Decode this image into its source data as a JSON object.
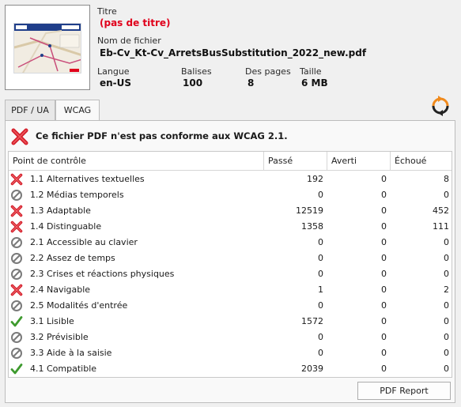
{
  "document": {
    "title_label": "Titre",
    "title_value": "(pas de titre)",
    "filename_label": "Nom de fichier",
    "filename_value": "Eb-Cv_Kt-Cv_ArretsBusSubstitution_2022_new.pdf",
    "language_label": "Langue",
    "language_value": "en-US",
    "tags_label": "Balises",
    "tags_value": "100",
    "pages_label": "Des pages",
    "pages_value": "8",
    "size_label": "Taille",
    "size_value": "6 MB"
  },
  "tabs": [
    {
      "label": "PDF / UA",
      "active": false
    },
    {
      "label": "WCAG",
      "active": true
    }
  ],
  "status": {
    "icon": "red-x-icon",
    "text": "Ce fichier PDF n'est pas conforme aux WCAG 2.1."
  },
  "table": {
    "columns": [
      "Point de contrôle",
      "Passé",
      "Averti",
      "Échoué"
    ],
    "rows": [
      {
        "status": "fail",
        "name": "1.1 Alternatives textuelles",
        "passed": "192",
        "warned": "0",
        "failed": "8"
      },
      {
        "status": "na",
        "name": "1.2 Médias temporels",
        "passed": "0",
        "warned": "0",
        "failed": "0"
      },
      {
        "status": "fail",
        "name": "1.3 Adaptable",
        "passed": "12519",
        "warned": "0",
        "failed": "452"
      },
      {
        "status": "fail",
        "name": "1.4 Distinguable",
        "passed": "1358",
        "warned": "0",
        "failed": "111"
      },
      {
        "status": "na",
        "name": "2.1 Accessible au clavier",
        "passed": "0",
        "warned": "0",
        "failed": "0"
      },
      {
        "status": "na",
        "name": "2.2 Assez de temps",
        "passed": "0",
        "warned": "0",
        "failed": "0"
      },
      {
        "status": "na",
        "name": "2.3 Crises et réactions physiques",
        "passed": "0",
        "warned": "0",
        "failed": "0"
      },
      {
        "status": "fail",
        "name": "2.4 Navigable",
        "passed": "1",
        "warned": "0",
        "failed": "2"
      },
      {
        "status": "na",
        "name": "2.5 Modalités d'entrée",
        "passed": "0",
        "warned": "0",
        "failed": "0"
      },
      {
        "status": "pass",
        "name": "3.1 Lisible",
        "passed": "1572",
        "warned": "0",
        "failed": "0"
      },
      {
        "status": "na",
        "name": "3.2 Prévisible",
        "passed": "0",
        "warned": "0",
        "failed": "0"
      },
      {
        "status": "na",
        "name": "3.3 Aide à la saisie",
        "passed": "0",
        "warned": "0",
        "failed": "0"
      },
      {
        "status": "pass",
        "name": "4.1 Compatible",
        "passed": "2039",
        "warned": "0",
        "failed": "0"
      }
    ]
  },
  "buttons": {
    "report_label": "PDF Report"
  },
  "colors": {
    "fail": "#d4202c",
    "pass": "#3e9a2e",
    "na": "#7a7a7a",
    "title_red": "#e0001b",
    "refresh_orange": "#f08a1c"
  }
}
